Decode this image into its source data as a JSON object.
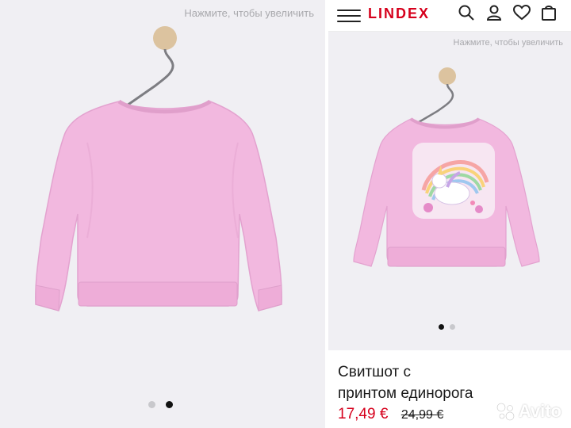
{
  "left_panel": {
    "zoom_hint": "Нажмите, чтобы увеличить",
    "carousel_dots": [
      {
        "active": false
      },
      {
        "active": true
      }
    ],
    "sweatshirt_color": "#f2b8df",
    "hanger_color": "#dcc39f"
  },
  "right_panel": {
    "brand": "LINDEX",
    "brand_color": "#d6001c",
    "header_icons": [
      "search-icon",
      "user-icon",
      "heart-icon",
      "bag-icon"
    ],
    "zoom_hint": "Нажмите, чтобы увеличить",
    "carousel_dots": [
      {
        "active": true
      },
      {
        "active": false
      }
    ],
    "product": {
      "title_line1": "Свитшот с",
      "title_line2": "принтом единорога",
      "price_new": "17,49  €",
      "price_old": "24,99 €"
    }
  },
  "watermark": {
    "text": "Avito"
  }
}
